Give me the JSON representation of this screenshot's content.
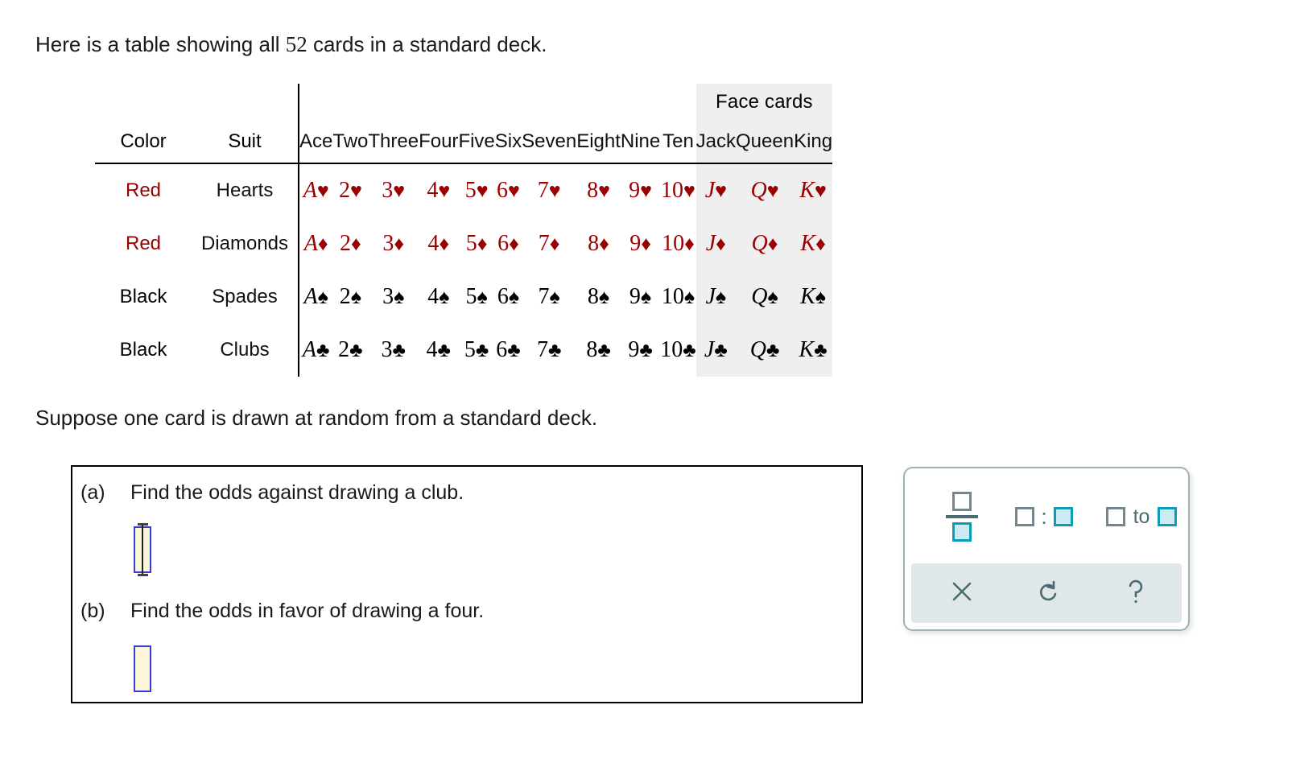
{
  "intro": {
    "before": "Here is a table showing all ",
    "count": "52",
    "after": " cards in a standard deck."
  },
  "deck_table": {
    "face_cards_banner": "Face cards",
    "column_headers": [
      "Color",
      "Suit",
      "Ace",
      "Two",
      "Three",
      "Four",
      "Five",
      "Six",
      "Seven",
      "Eight",
      "Nine",
      "Ten",
      "Jack",
      "Queen",
      "King"
    ],
    "rows": [
      {
        "color": "Red",
        "suit": "Hearts",
        "symbol": "♥",
        "color_hex": "#9a0000",
        "ranks": [
          "A",
          "2",
          "3",
          "4",
          "5",
          "6",
          "7",
          "8",
          "9",
          "10",
          "J",
          "Q",
          "K"
        ],
        "cards": [
          "A♥",
          "2♥",
          "3♥",
          "4♥",
          "5♥",
          "6♥",
          "7♥",
          "8♥",
          "9♥",
          "10♥",
          "J♥",
          "Q♥",
          "K♥"
        ]
      },
      {
        "color": "Red",
        "suit": "Diamonds",
        "symbol": "♦",
        "color_hex": "#9a0000",
        "ranks": [
          "A",
          "2",
          "3",
          "4",
          "5",
          "6",
          "7",
          "8",
          "9",
          "10",
          "J",
          "Q",
          "K"
        ],
        "cards": [
          "A♦",
          "2♦",
          "3♦",
          "4♦",
          "5♦",
          "6♦",
          "7♦",
          "8♦",
          "9♦",
          "10♦",
          "J♦",
          "Q♦",
          "K♦"
        ]
      },
      {
        "color": "Black",
        "suit": "Spades",
        "symbol": "♠",
        "color_hex": "#000000",
        "ranks": [
          "A",
          "2",
          "3",
          "4",
          "5",
          "6",
          "7",
          "8",
          "9",
          "10",
          "J",
          "Q",
          "K"
        ],
        "cards": [
          "A♠",
          "2♠",
          "3♠",
          "4♠",
          "5♠",
          "6♠",
          "7♠",
          "8♠",
          "9♠",
          "10♠",
          "J♠",
          "Q♠",
          "K♠"
        ]
      },
      {
        "color": "Black",
        "suit": "Clubs",
        "symbol": "♣",
        "color_hex": "#000000",
        "ranks": [
          "A",
          "2",
          "3",
          "4",
          "5",
          "6",
          "7",
          "8",
          "9",
          "10",
          "J",
          "Q",
          "K"
        ],
        "cards": [
          "A♣",
          "2♣",
          "3♣",
          "4♣",
          "5♣",
          "6♣",
          "7♣",
          "8♣",
          "9♣",
          "10♣",
          "J♣",
          "Q♣",
          "K♣"
        ]
      }
    ],
    "shaded_columns": [
      "Jack",
      "Queen",
      "King"
    ],
    "shade_hex": "#efefef"
  },
  "prompt": "Suppose one card is drawn at random from a standard deck.",
  "questions": [
    {
      "label": "(a)",
      "text": "Find the odds against drawing a club.",
      "answer_value": "",
      "focused": true
    },
    {
      "label": "(b)",
      "text": "Find the odds in favor of drawing a four.",
      "answer_value": "",
      "focused": false
    }
  ],
  "keypad": {
    "templates": [
      {
        "name": "fraction",
        "label": "□/□"
      },
      {
        "name": "ratio-colon",
        "label": "□:□",
        "separator": ":"
      },
      {
        "name": "ratio-to",
        "label": "□ to □",
        "separator": "to"
      }
    ],
    "actions": [
      {
        "name": "clear",
        "glyph": "×"
      },
      {
        "name": "undo",
        "glyph": "↺"
      },
      {
        "name": "help",
        "glyph": "?"
      }
    ],
    "accent_hex": "#0b9cb8",
    "accent_fill_hex": "#cbeaf1",
    "muted_hex": "#74868c",
    "tray_hex": "#dfe7e8"
  }
}
